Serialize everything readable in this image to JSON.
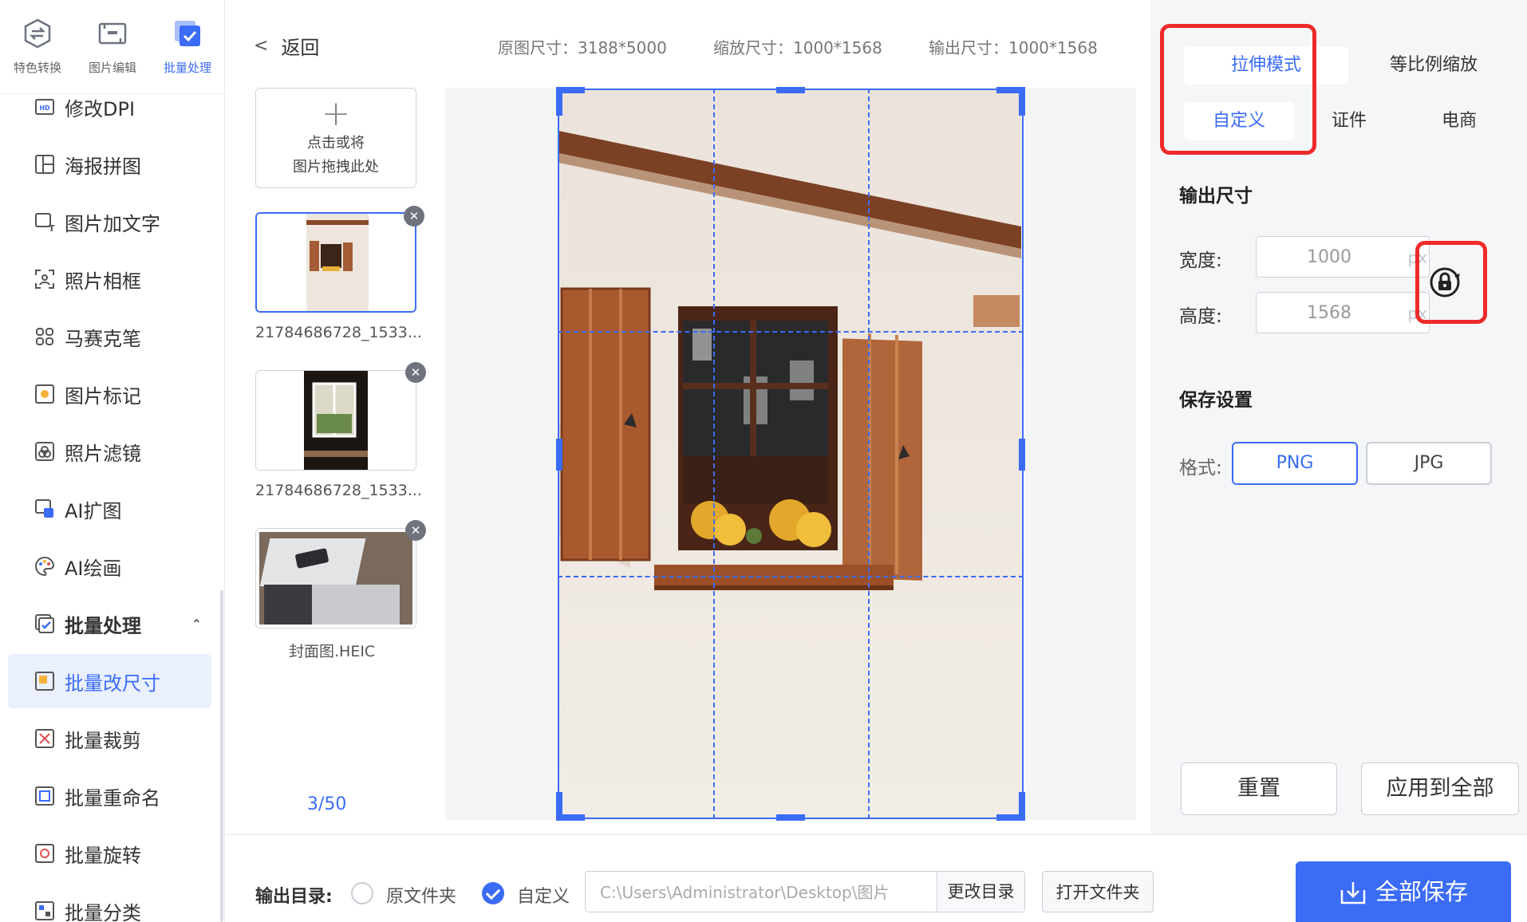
{
  "top_tabs": [
    {
      "label": "特色转换",
      "icon": "convert-icon"
    },
    {
      "label": "图片编辑",
      "icon": "image-edit-icon"
    },
    {
      "label": "批量处理",
      "icon": "batch-icon",
      "active": true
    }
  ],
  "sidebar": {
    "items": [
      {
        "label": "修改DPI",
        "icon": "dpi-icon"
      },
      {
        "label": "海报拼图",
        "icon": "collage-icon"
      },
      {
        "label": "图片加文字",
        "icon": "add-text-icon"
      },
      {
        "label": "照片相框",
        "icon": "photo-frame-icon"
      },
      {
        "label": "马赛克笔",
        "icon": "mosaic-icon"
      },
      {
        "label": "图片标记",
        "icon": "mark-icon"
      },
      {
        "label": "照片滤镜",
        "icon": "filter-icon"
      },
      {
        "label": "AI扩图",
        "icon": "ai-expand-icon"
      },
      {
        "label": "AI绘画",
        "icon": "ai-paint-icon"
      },
      {
        "label": "批量处理",
        "icon": "batch-icon",
        "group": true
      },
      {
        "label": "批量改尺寸",
        "icon": "resize-icon",
        "active": true
      },
      {
        "label": "批量裁剪",
        "icon": "crop-icon"
      },
      {
        "label": "批量重命名",
        "icon": "rename-icon"
      },
      {
        "label": "批量旋转",
        "icon": "rotate-icon"
      },
      {
        "label": "批量分类",
        "icon": "classify-icon"
      }
    ]
  },
  "header": {
    "back_label": "返回",
    "original_size": "原图尺寸：3188*5000",
    "scaled_size": "缩放尺寸：1000*1568",
    "output_size": "输出尺寸：1000*1568"
  },
  "upload": {
    "line1": "点击或将",
    "line2": "图片拖拽此处"
  },
  "thumbnails": [
    {
      "caption": "21784686728_1533..."
    },
    {
      "caption": "21784686728_1533..."
    },
    {
      "caption": "封面图.HEIC"
    }
  ],
  "counter": "3/50",
  "right_panel": {
    "mode_tabs": [
      "拉伸模式",
      "等比例缩放"
    ],
    "preset_tabs": [
      "自定义",
      "证件",
      "电商"
    ],
    "output_title": "输出尺寸",
    "width_label": "宽度:",
    "width_value": "1000",
    "height_label": "高度:",
    "height_value": "1568",
    "unit": "px",
    "save_title": "保存设置",
    "format_label": "格式:",
    "formats": [
      "PNG",
      "JPG"
    ],
    "reset_label": "重置",
    "apply_all_label": "应用到全部"
  },
  "bottom": {
    "output_dir_label": "输出目录:",
    "option_original": "原文件夹",
    "option_custom": "自定义",
    "path": "C:\\Users\\Administrator\\Desktop\\图片",
    "change_dir_label": "更改目录",
    "open_folder_label": "打开文件夹",
    "save_all_label": "全部保存"
  },
  "colors": {
    "accent": "#3b6cf6",
    "highlight": "#ee2a2a"
  }
}
